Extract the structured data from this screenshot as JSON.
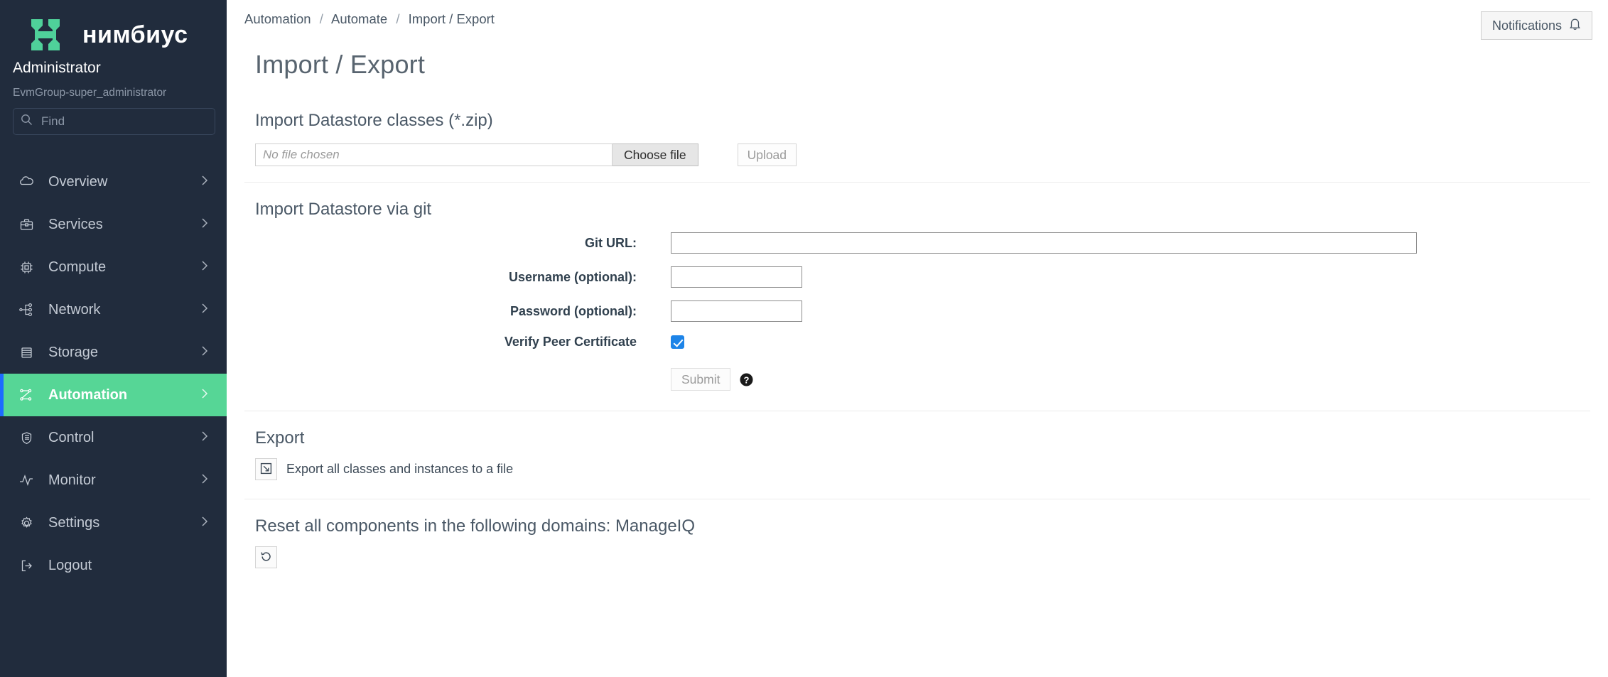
{
  "sidebar": {
    "brand": {
      "name": "нимбиус",
      "logo_icon": "nimbus-h-logo",
      "logo_color": "#4fd19a"
    },
    "user": {
      "name": "Administrator",
      "group": "EvmGroup-super_administrator"
    },
    "search": {
      "placeholder": "Find",
      "value": "",
      "icon": "search-icon"
    },
    "items": [
      {
        "label": "Overview",
        "icon": "cloud-icon",
        "active": false,
        "chevron": true
      },
      {
        "label": "Services",
        "icon": "briefcase-icon",
        "active": false,
        "chevron": true
      },
      {
        "label": "Compute",
        "icon": "cpu-icon",
        "active": false,
        "chevron": true
      },
      {
        "label": "Network",
        "icon": "network-icon",
        "active": false,
        "chevron": true
      },
      {
        "label": "Storage",
        "icon": "storage-icon",
        "active": false,
        "chevron": true
      },
      {
        "label": "Automation",
        "icon": "automation-icon",
        "active": true,
        "chevron": true
      },
      {
        "label": "Control",
        "icon": "shield-icon",
        "active": false,
        "chevron": true
      },
      {
        "label": "Monitor",
        "icon": "pulse-icon",
        "active": false,
        "chevron": true
      },
      {
        "label": "Settings",
        "icon": "gear-icon",
        "active": false,
        "chevron": true
      },
      {
        "label": "Logout",
        "icon": "logout-icon",
        "active": false,
        "chevron": false
      }
    ],
    "active_color": "#56d696",
    "active_accent_color": "#1d6bff",
    "background_color": "#212c3d"
  },
  "header": {
    "breadcrumb": [
      "Automation",
      "Automate",
      "Import / Export"
    ],
    "separator": "/",
    "notifications": {
      "label": "Notifications",
      "icon": "bell-icon"
    }
  },
  "page": {
    "title": "Import / Export"
  },
  "import_zip": {
    "heading": "Import Datastore classes (*.zip)",
    "file_value": "",
    "file_placeholder": "No file chosen",
    "choose_label": "Choose file",
    "upload_label": "Upload",
    "upload_disabled": true
  },
  "import_git": {
    "heading": "Import Datastore via git",
    "fields": [
      {
        "label": "Git URL:",
        "value": "",
        "type": "url"
      },
      {
        "label": "Username (optional):",
        "value": "",
        "type": "text"
      },
      {
        "label": "Password (optional):",
        "value": "",
        "type": "password"
      }
    ],
    "verify": {
      "label": "Verify Peer Certificate",
      "checked": true
    },
    "submit_label": "Submit",
    "submit_disabled": true,
    "help_icon": "help-circle-icon"
  },
  "export": {
    "heading": "Export",
    "action_text": "Export all classes and instances to a file",
    "icon": "export-icon"
  },
  "reset": {
    "heading": "Reset all components in the following domains: ManageIQ",
    "icon": "reset-icon"
  }
}
